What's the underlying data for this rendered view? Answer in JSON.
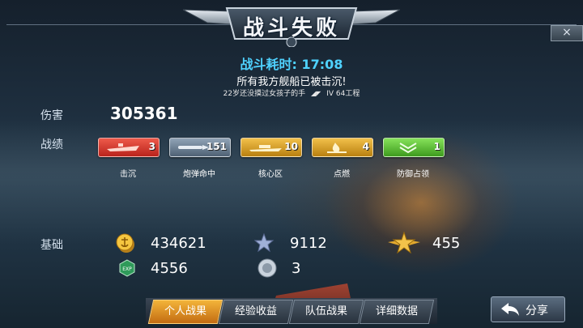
{
  "title": "战斗失败",
  "close_icon": "×",
  "duration_label": "战斗耗时:",
  "duration_value": "17:08",
  "result_message": "所有我方舰船已被击沉!",
  "player": {
    "name": "22岁还没摸过女孩子的手",
    "tier": "IV",
    "ship": "64工程"
  },
  "damage": {
    "label": "伤害",
    "value": "305361"
  },
  "achievements": {
    "label": "战绩",
    "items": [
      {
        "icon": "warship-sunk-icon",
        "count": "3",
        "caption": "击沉",
        "color": "#d8332a"
      },
      {
        "icon": "shell-hit-icon",
        "count": "151",
        "caption": "炮弹命中",
        "color": "#6c7f93"
      },
      {
        "icon": "citadel-icon",
        "count": "10",
        "caption": "核心区",
        "color": "#d9a322"
      },
      {
        "icon": "fire-icon",
        "count": "4",
        "caption": "点燃",
        "color": "#d9a322"
      },
      {
        "icon": "defense-capture-icon",
        "count": "1",
        "caption": "防御占领",
        "color": "#59c236"
      }
    ]
  },
  "basic": {
    "label": "基础",
    "credits": "434621",
    "free_exp": "9112",
    "captain_exp": "455",
    "exp": "4556",
    "silver": "3"
  },
  "tabs": [
    "个人战果",
    "经验收益",
    "队伍战果",
    "详细数据"
  ],
  "active_tab": 0,
  "share_label": "分享"
}
